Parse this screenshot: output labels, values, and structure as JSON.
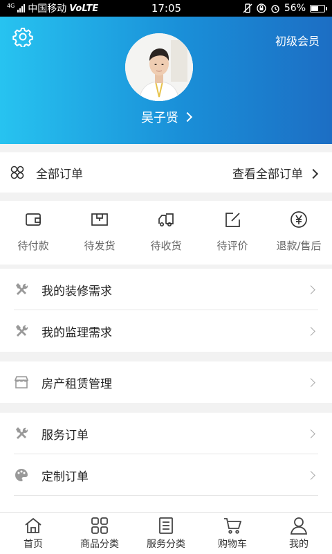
{
  "status_bar": {
    "network_type": "4G",
    "carrier": "中国移动",
    "volte": "VoLTE",
    "time": "17:05",
    "battery": "56%",
    "battery_level": 0.56
  },
  "header": {
    "member_level": "初级会员",
    "username": "吴子贤",
    "gradient_start": "#27c3f0",
    "gradient_end": "#1c6ec4"
  },
  "orders": {
    "title": "全部订单",
    "view_all": "查看全部订单"
  },
  "order_status": [
    {
      "label": "待付款",
      "icon": "wallet-icon"
    },
    {
      "label": "待发货",
      "icon": "package-icon"
    },
    {
      "label": "待收货",
      "icon": "truck-icon"
    },
    {
      "label": "待评价",
      "icon": "edit-icon"
    },
    {
      "label": "退款/售后",
      "icon": "yen-icon"
    }
  ],
  "menu_group1": [
    {
      "label": "我的装修需求",
      "icon": "tools-icon"
    },
    {
      "label": "我的监理需求",
      "icon": "tools-icon"
    }
  ],
  "menu_group2": [
    {
      "label": "房产租赁管理",
      "icon": "store-icon"
    }
  ],
  "menu_group3": [
    {
      "label": "服务订单",
      "icon": "tools-icon"
    },
    {
      "label": "定制订单",
      "icon": "palette-icon"
    }
  ],
  "tabbar": [
    {
      "label": "首页",
      "icon": "home-icon"
    },
    {
      "label": "商品分类",
      "icon": "grid-icon"
    },
    {
      "label": "服务分类",
      "icon": "document-icon"
    },
    {
      "label": "购物车",
      "icon": "cart-icon"
    },
    {
      "label": "我的",
      "icon": "user-icon"
    }
  ]
}
